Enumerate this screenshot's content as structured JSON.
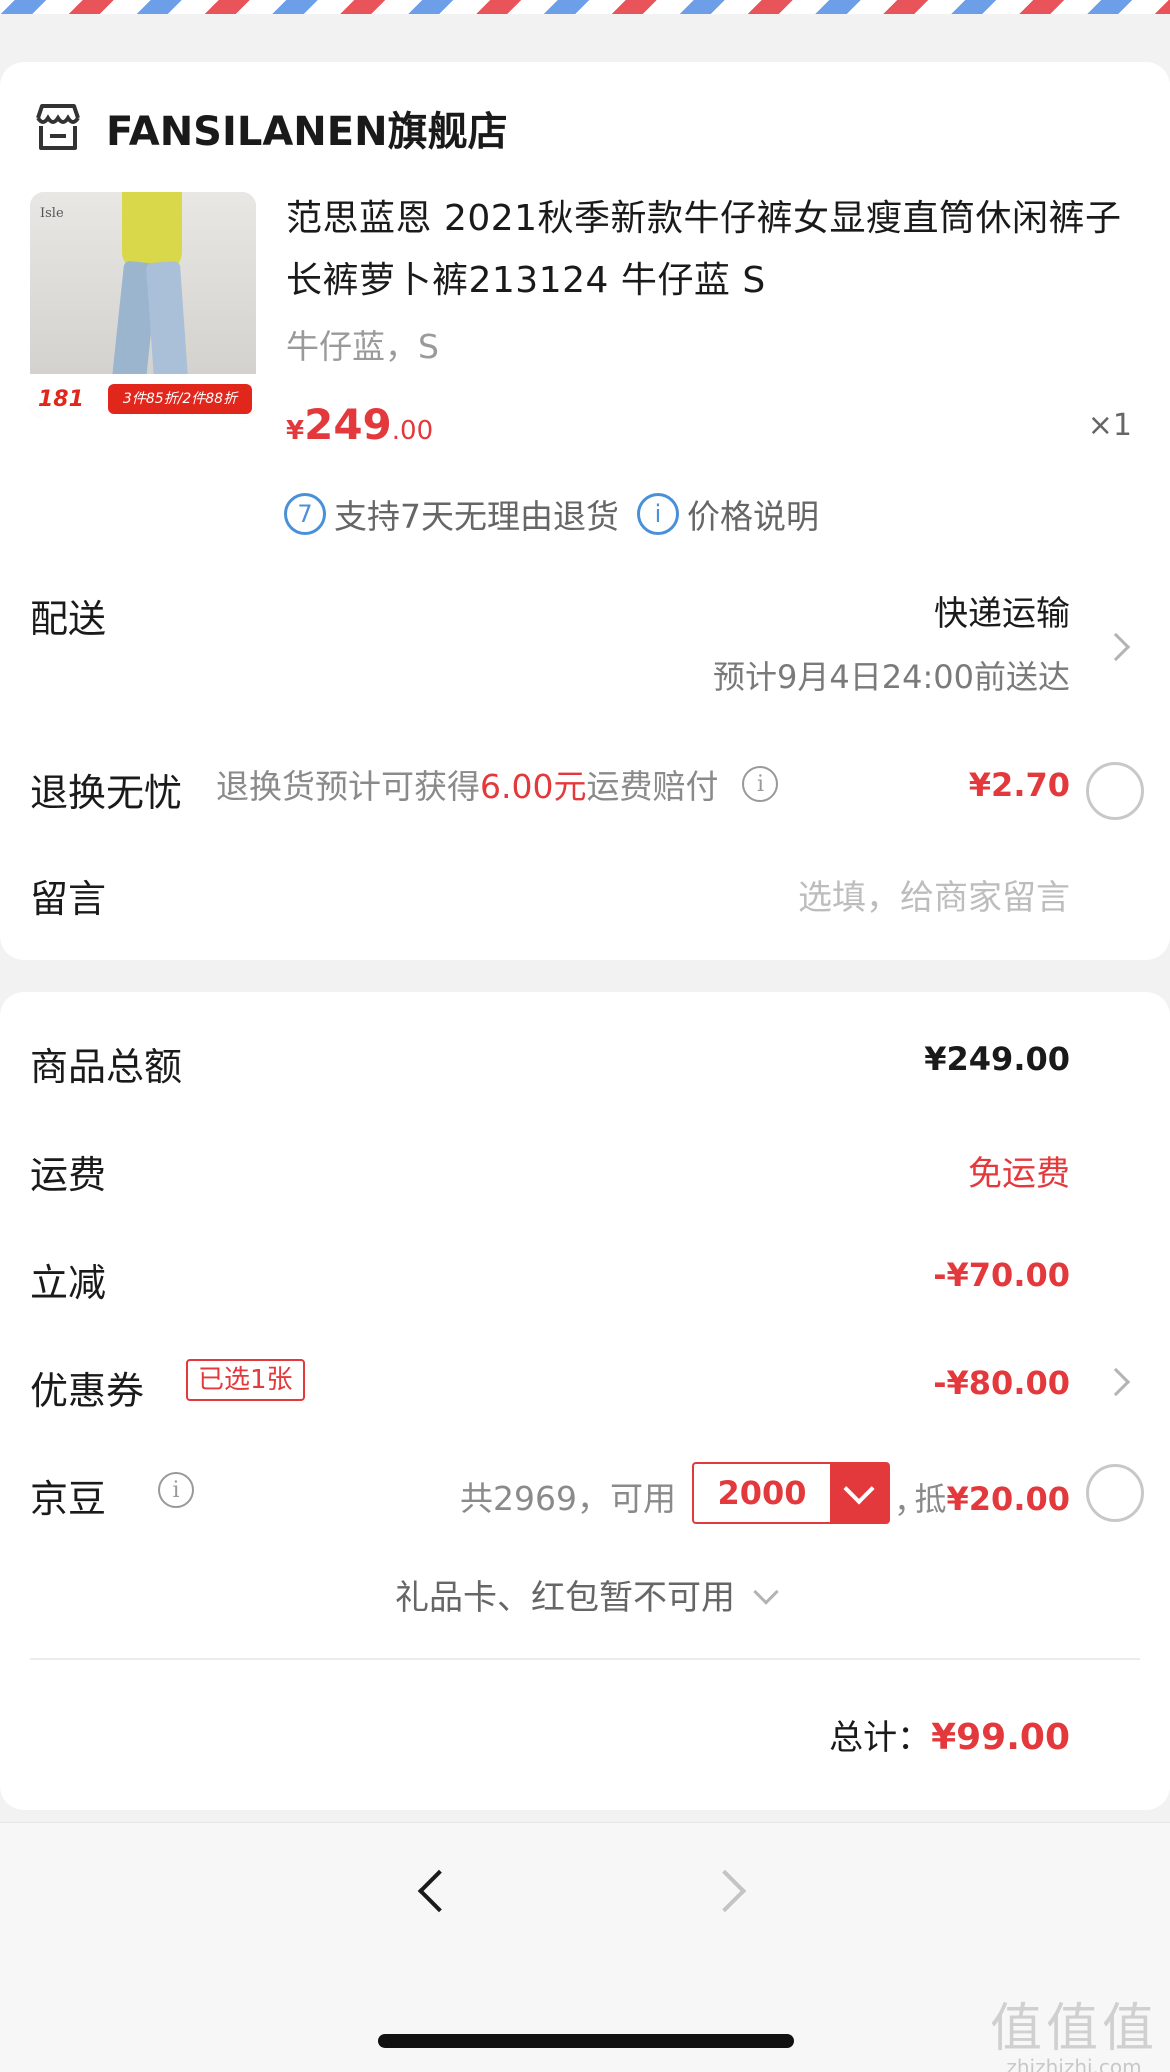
{
  "shop": {
    "name": "FANSILANEN旗舰店",
    "icon": "store-icon"
  },
  "product": {
    "title": "范思蓝恩 2021秋季新款牛仔裤女显瘦直筒休闲裤子长裤萝卜裤213124 牛仔蓝 S",
    "spec": "牛仔蓝，S",
    "price_symbol": "¥",
    "price_int": "249",
    "price_dec": ".00",
    "quantity": "×1",
    "thumb": {
      "brand": "Isle",
      "promo_price": "181",
      "promo_text": "3件85折/2件88折"
    },
    "badges": [
      {
        "icon_text": "7",
        "label": "支持7天无理由退货"
      },
      {
        "icon_text": "i",
        "label": "价格说明"
      }
    ]
  },
  "delivery": {
    "label": "配送",
    "method": "快递运输",
    "eta": "预计9月4日24:00前送达"
  },
  "return_insurance": {
    "label": "退换无忧",
    "desc_prefix": "退换货预计可获得",
    "desc_amount": "6.00元",
    "desc_suffix": "运费赔付",
    "price": "¥2.70"
  },
  "message": {
    "label": "留言",
    "placeholder": "选填，给商家留言"
  },
  "summary": {
    "goods_label": "商品总额",
    "goods_value": "¥249.00",
    "shipping_label": "运费",
    "shipping_value": "免运费",
    "discount_label": "立减",
    "discount_value": "-¥70.00",
    "coupon_label": "优惠券",
    "coupon_tag": "已选1张",
    "coupon_value": "-¥80.00",
    "beans_label": "京豆",
    "beans_total": "共2969，可用",
    "beans_selected": "2000",
    "beans_comma": "，",
    "beans_deduct_prefix": "抵",
    "beans_deduct_value": "¥20.00",
    "giftcard_text": "礼品卡、红包暂不可用",
    "total_label": "总计：",
    "total_value": "¥99.00"
  },
  "watermark": {
    "main": "值值值",
    "sub": "zhizhizhi.com"
  },
  "colors": {
    "accent": "#e4393c",
    "link_blue": "#4a90d9"
  }
}
